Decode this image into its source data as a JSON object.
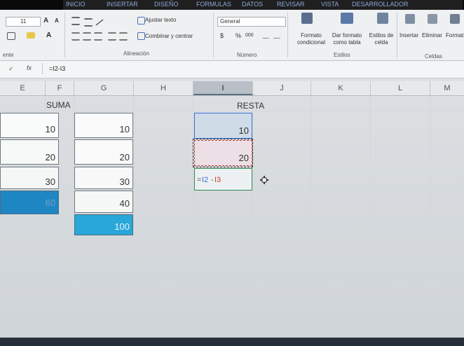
{
  "top_fragments": [
    "INICIO",
    "INSERTAR",
    "DISEÑO",
    "FORMULAS",
    "DATOS",
    "REVISAR",
    "VISTA",
    "DESARROLLADOR"
  ],
  "ribbon": {
    "font_size": "11",
    "font_grow": "A",
    "font_shrink": "A",
    "fill_color_label": "A",
    "wrap_text": "Ajustar texto",
    "merge_center": "Combinar y centrar",
    "number_format": "General",
    "currency": "$",
    "percent": "%",
    "thousands": "000",
    "conditional_format": "Formato condicional",
    "format_table": "Dar formato como tabla",
    "cell_styles": "Estilos de celda",
    "insert": "Insertar",
    "delete": "Eliminar",
    "format": "Format",
    "group_font_fragment": "ente",
    "group_alignment": "Alineación",
    "group_number": "Número",
    "group_styles": "Estilos",
    "group_cells": "Celdas"
  },
  "formula_bar": {
    "check": "✓",
    "fx": "fx",
    "formula": "=I2-I3"
  },
  "columns": [
    "E",
    "F",
    "G",
    "H",
    "I",
    "J",
    "K",
    "L",
    "M"
  ],
  "active_column": "I",
  "suma": {
    "header": "SUMA",
    "col_e": [
      "10",
      "20",
      "30",
      "60"
    ],
    "col_g": [
      "10",
      "20",
      "30",
      "40",
      "100"
    ]
  },
  "resta": {
    "header": "RESTA",
    "values": [
      "10",
      "20"
    ],
    "editing_formula_eq": "=",
    "editing_ref1": "I2",
    "editing_minus": "-",
    "editing_ref2": "I3"
  },
  "colors": {
    "accent_blue": "#1f86c4",
    "suma_total_blue": "#28a7d8",
    "selection_green": "#2e8b57",
    "ref_blue": "#3a6fd8",
    "ref_red": "#c0392b"
  }
}
